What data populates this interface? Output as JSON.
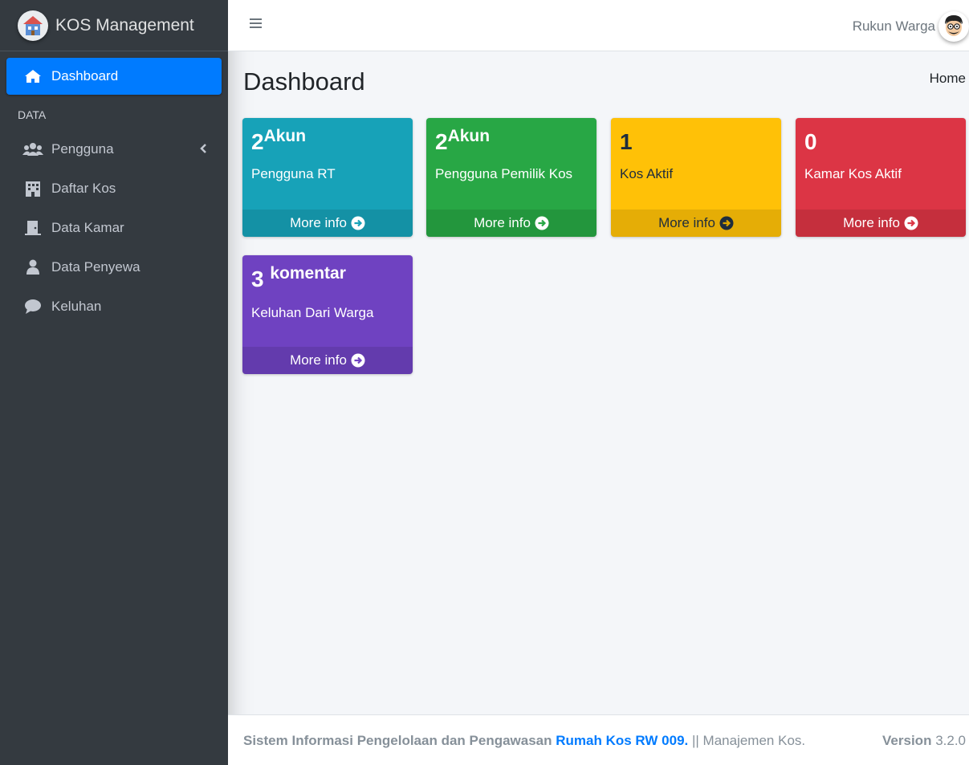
{
  "brand": {
    "title": "KOS Management"
  },
  "sidebar": {
    "items": [
      {
        "label": "Dashboard",
        "icon": "home-icon",
        "active": true
      },
      {
        "label": "Pengguna",
        "icon": "users-icon"
      },
      {
        "label": "Daftar Kos",
        "icon": "building-icon"
      },
      {
        "label": "Data Kamar",
        "icon": "door-icon"
      },
      {
        "label": "Data Penyewa",
        "icon": "user-icon"
      },
      {
        "label": "Keluhan",
        "icon": "comment-icon"
      }
    ],
    "header": "DATA"
  },
  "navbar": {
    "user_name": "Rukun Warga"
  },
  "page": {
    "title": "Dashboard",
    "breadcrumb": "Home"
  },
  "cards": [
    {
      "number": "2",
      "unit": "Akun",
      "label": "Pengguna RT",
      "more": "More info",
      "color": "#17a2b8"
    },
    {
      "number": "2",
      "unit": "Akun",
      "label": "Pengguna Pemilik Kos",
      "more": "More info",
      "color": "#28a745"
    },
    {
      "number": "1",
      "unit": "",
      "label": "Kos Aktif",
      "more": "More info",
      "color": "#ffc107"
    },
    {
      "number": "0",
      "unit": "",
      "label": "Kamar Kos Aktif",
      "more": "More info",
      "color": "#dc3545"
    },
    {
      "number": "3",
      "unit": "komentar",
      "label": "Keluhan Dari Warga",
      "more": "More info",
      "color": "#6f42c1"
    }
  ],
  "footer": {
    "text_bold": "Sistem Informasi Pengelolaan dan Pengawasan",
    "link": "Rumah Kos RW 009.",
    "text_rest": "|| Manajemen Kos.",
    "version_label": "Version",
    "version": "3.2.0"
  }
}
